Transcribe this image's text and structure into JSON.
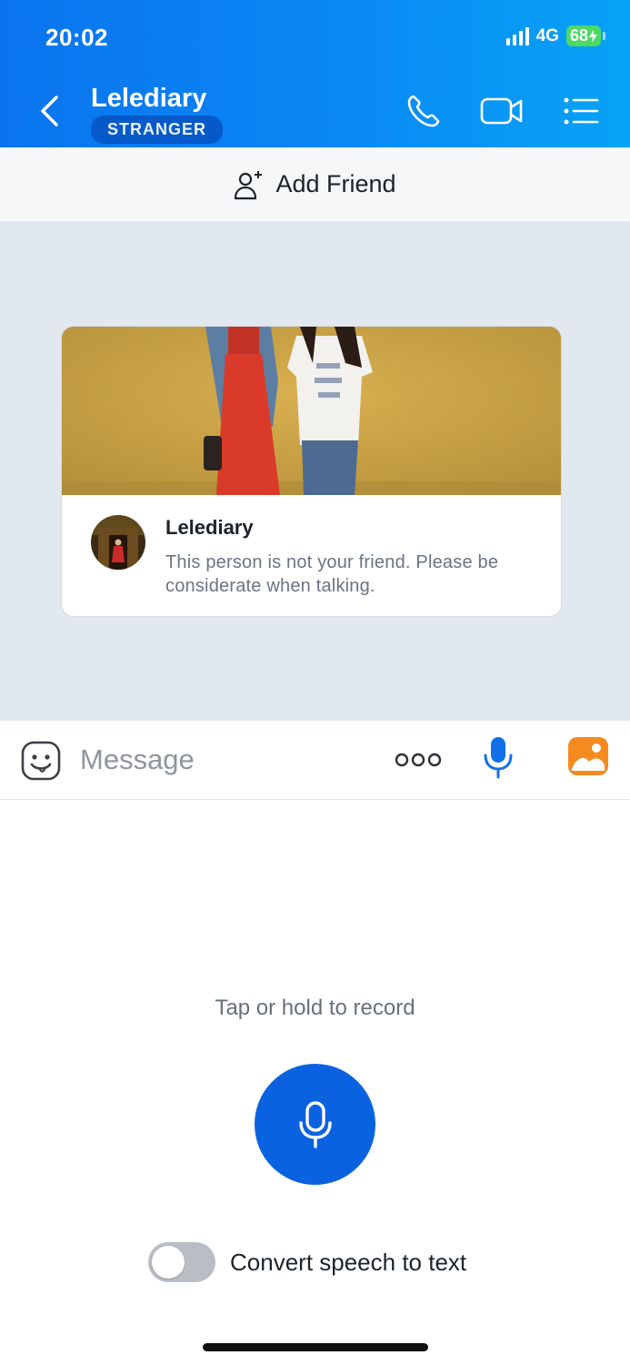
{
  "status_bar": {
    "time": "20:02",
    "network": "4G",
    "battery": "68"
  },
  "header": {
    "contact_name": "Lelediary",
    "badge": "STRANGER"
  },
  "add_friend": {
    "label": "Add Friend"
  },
  "profile_card": {
    "name": "Lelediary",
    "note": "This person is not your friend. Please be considerate when talking."
  },
  "composer": {
    "placeholder": "Message"
  },
  "voice_panel": {
    "hint": "Tap or hold to record",
    "speech_to_text_label": "Convert speech to text",
    "speech_to_text_enabled": false
  },
  "colors": {
    "header_start": "#0a74ee",
    "header_end": "#07a3f6",
    "record_button": "#0a62e0",
    "badge": "#0559c9"
  }
}
